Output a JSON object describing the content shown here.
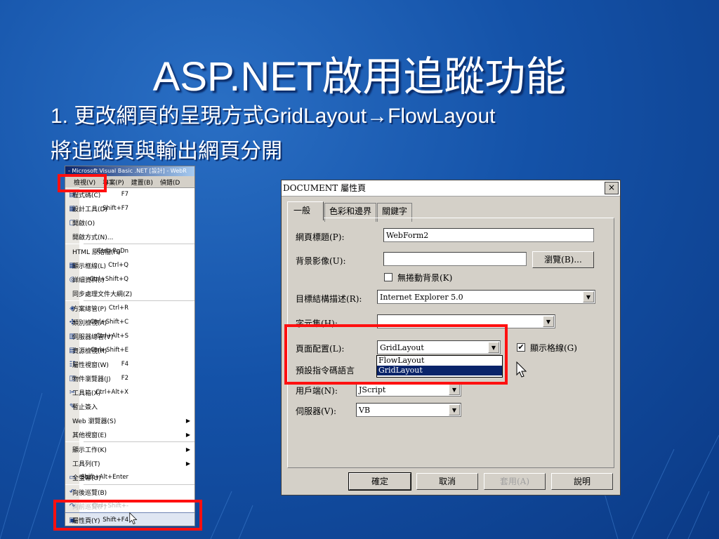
{
  "slide": {
    "title": "ASP.NET啟用追蹤功能",
    "bullet1": "1. 更改網頁的呈現方式GridLayout→FlowLayout",
    "bullet2": "將追蹤頁與輸出網頁分開"
  },
  "menu_window": {
    "title": "- Microsoft Visual Basic .NET [設計] - WebR",
    "menubar": [
      "檢視(V)",
      "專案(P)",
      "建置(B)",
      "偵錯(D"
    ],
    "items": [
      {
        "label": "程式碼(C)",
        "shortcut": "F7",
        "icon": "code-icon"
      },
      {
        "label": "設計工具(D)",
        "shortcut": "Shift+F7",
        "icon": "designer-icon"
      },
      {
        "label": "開啟(O)",
        "shortcut": "",
        "icon": "open-icon"
      },
      {
        "label": "開啟方式(N)...",
        "shortcut": "",
        "icon": ""
      },
      {
        "label": "HTML 原始檔(H)",
        "shortcut": "Ctrl+PgDn",
        "icon": ""
      },
      {
        "label": "顯示框線(L)",
        "shortcut": "Ctrl+Q",
        "icon": "borders-icon"
      },
      {
        "label": "詳細資料(I)",
        "shortcut": "Ctrl+Shift+Q",
        "icon": "details-icon"
      },
      {
        "label": "同步處理文件大綱(Z)",
        "shortcut": "",
        "icon": ""
      },
      {
        "label": "方案總管(P)",
        "shortcut": "Ctrl+R",
        "icon": "solution-explorer-icon"
      },
      {
        "label": "類別檢視(A)",
        "shortcut": "Ctrl+Shift+C",
        "icon": "class-view-icon"
      },
      {
        "label": "伺服器總管(V)",
        "shortcut": "Ctrl+Alt+S",
        "icon": "server-explorer-icon"
      },
      {
        "label": "資源檢視(R)",
        "shortcut": "Ctrl+Shift+E",
        "icon": "resource-view-icon"
      },
      {
        "label": "屬性視窗(W)",
        "shortcut": "F4",
        "icon": "properties-window-icon"
      },
      {
        "label": "物件瀏覽器(J)",
        "shortcut": "F2",
        "icon": "object-browser-icon"
      },
      {
        "label": "工具箱(X)",
        "shortcut": "Ctrl+Alt+X",
        "icon": "toolbox-icon"
      },
      {
        "label": "暫止簽入",
        "shortcut": "",
        "icon": "pending-checkin-icon"
      },
      {
        "label": "Web 瀏覽器(S)",
        "shortcut": "",
        "icon": "",
        "submenu": true
      },
      {
        "label": "其他視窗(E)",
        "shortcut": "",
        "icon": "",
        "submenu": true
      },
      {
        "label": "顯示工作(K)",
        "shortcut": "",
        "icon": "",
        "submenu": true
      },
      {
        "label": "工具列(T)",
        "shortcut": "",
        "icon": "",
        "submenu": true
      },
      {
        "label": "全螢幕(U)",
        "shortcut": "Shift+Alt+Enter",
        "icon": "fullscreen-icon"
      },
      {
        "label": "向後巡覽(B)",
        "shortcut": "",
        "icon": "navigate-back-icon"
      },
      {
        "label": "向前巡覽(F)",
        "shortcut": "Ctrl+Shift+-",
        "icon": "navigate-forward-icon",
        "disabled": true
      },
      {
        "label": "屬性頁(Y)",
        "shortcut": "Shift+F4",
        "icon": "property-pages-icon",
        "highlighted": true
      }
    ]
  },
  "dialog": {
    "title": "DOCUMENT 屬性頁",
    "close": "×",
    "tabs": [
      "一般",
      "色彩和邊界",
      "關鍵字"
    ],
    "fields": {
      "page_title_label": "網頁標題(P):",
      "page_title_value": "WebForm2",
      "bg_image_label": "背景影像(U):",
      "bg_image_value": "",
      "browse_button": "瀏覽(B)...",
      "no_scroll_bg_label": "無捲動背景(K)",
      "target_schema_label": "目標結構描述(R):",
      "target_schema_value": "Internet Explorer 5.0",
      "charset_label": "字元集(H):",
      "charset_value": "",
      "page_layout_label": "頁面配置(L):",
      "page_layout_value": "GridLayout",
      "page_layout_options": [
        "FlowLayout",
        "GridLayout"
      ],
      "show_grid_label": "顯示格線(G)",
      "show_grid_checked": "✔",
      "default_lang_label": "預設指令碼語言",
      "client_label": "用戶端(N):",
      "client_value": "JScript",
      "server_label": "伺服器(V):",
      "server_value": "VB"
    },
    "buttons": {
      "ok": "確定",
      "cancel": "取消",
      "apply": "套用(A)",
      "help": "說明"
    }
  },
  "colors": {
    "highlight_box": "#ff1010",
    "slide_bg": "#1452a8",
    "selection": "#0a246a"
  }
}
